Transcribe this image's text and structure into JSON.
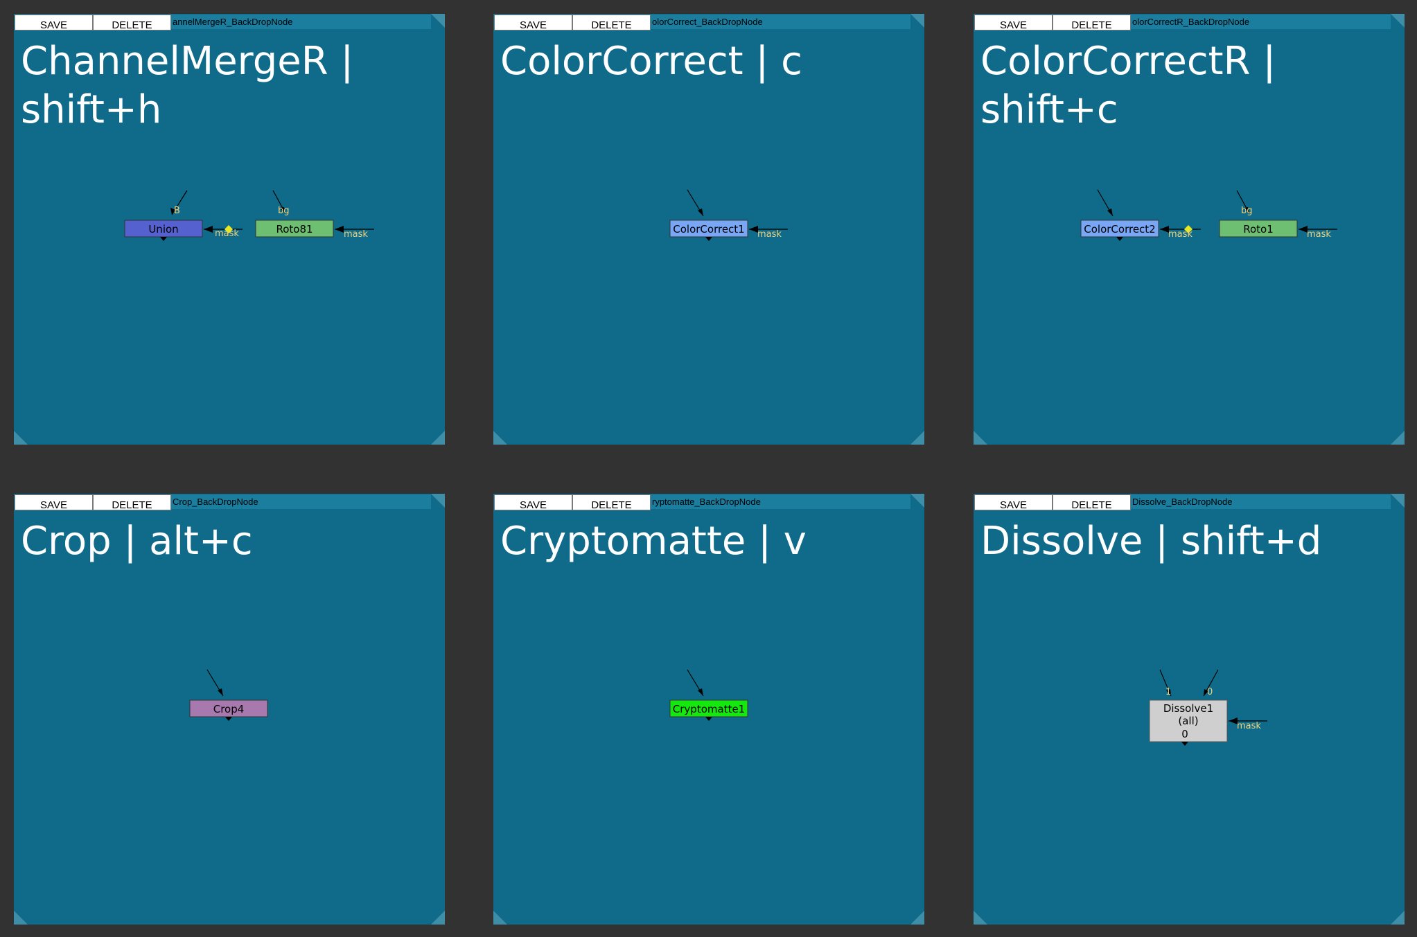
{
  "toolbar": {
    "save_label": "SAVE",
    "delete_label": "DELETE"
  },
  "backdrops": [
    {
      "node_name": "annelMergeR_BackDropNode",
      "label": "ChannelMergeR | shift+h",
      "nodes": [
        {
          "label": "Union",
          "color": "#5461ce"
        },
        {
          "label": "Roto81",
          "color": "#6fbf73"
        }
      ],
      "inputs": [
        "B",
        "mask",
        "bg",
        "mask"
      ]
    },
    {
      "node_name": "olorCorrect_BackDropNode",
      "label": "ColorCorrect | c",
      "nodes": [
        {
          "label": "ColorCorrect1",
          "color": "#7aa7f5"
        }
      ],
      "inputs": [
        "mask"
      ]
    },
    {
      "node_name": "olorCorrectR_BackDropNode",
      "label": "ColorCorrectR | shift+c",
      "nodes": [
        {
          "label": "ColorCorrect2",
          "color": "#7aa7f5"
        },
        {
          "label": "Roto1",
          "color": "#6fbf73"
        }
      ],
      "inputs": [
        "mask",
        "bg",
        "mask"
      ]
    },
    {
      "node_name": "Crop_BackDropNode",
      "label": "Crop | alt+c",
      "nodes": [
        {
          "label": "Crop4",
          "color": "#a779ae"
        }
      ],
      "inputs": []
    },
    {
      "node_name": "ryptomatte_BackDropNode",
      "label": "Cryptomatte | v",
      "nodes": [
        {
          "label": "Cryptomatte1",
          "color": "#15e80f"
        }
      ],
      "inputs": []
    },
    {
      "node_name": "Dissolve_BackDropNode",
      "label": "Dissolve | shift+d",
      "nodes": [
        {
          "label": "Dissolve1",
          "sublabel": "(all)",
          "value": "0",
          "color": "#cfcfcf"
        }
      ],
      "inputs": [
        "1",
        "0",
        "mask"
      ]
    }
  ]
}
